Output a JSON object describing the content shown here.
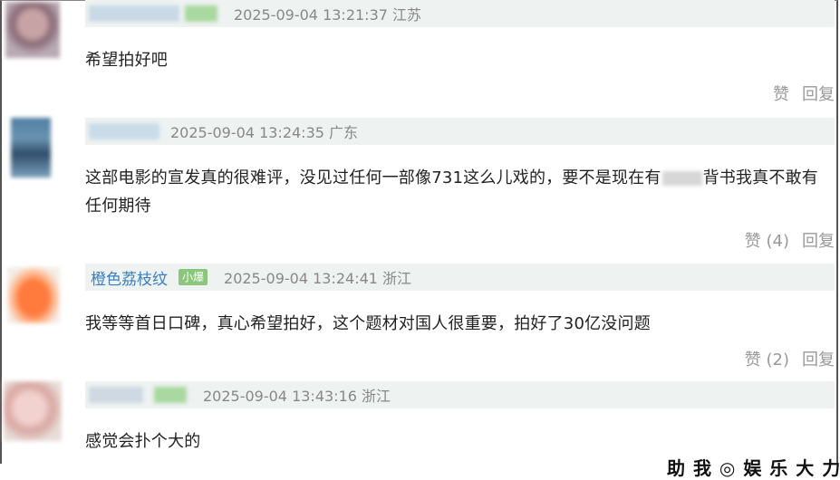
{
  "comments": [
    {
      "timestamp": "2025-09-04 13:21:37",
      "location": "江苏",
      "text": "希望拍好吧",
      "like_label": "赞",
      "reply_label": "回复"
    },
    {
      "timestamp": "2025-09-04 13:24:35",
      "location": "广东",
      "text_before": "这部电影的宣发真的很难评，没见过任何一部像731这么儿戏的，要不是现在有",
      "text_after": "背书我真不敢有任何期待",
      "like_label": "赞 (4)",
      "reply_label": "回复"
    },
    {
      "username": "橙色荔枝纹",
      "badge": "小爆",
      "timestamp": "2025-09-04 13:24:41",
      "location": "浙江",
      "text": "我等等首日口碑，真心希望拍好，这个题材对国人很重要，拍好了30亿没问题",
      "like_label": "赞 (2)",
      "reply_label": "回复"
    },
    {
      "timestamp": "2025-09-04 13:43:16",
      "location": "浙江",
      "text": "感觉会扑个大的"
    }
  ],
  "watermark": "助 我 ◎ 娱 乐 大 力",
  "colors": {
    "header_bg": "#eef2f1",
    "username": "#3a7fbf",
    "badge": "#8ac77c",
    "muted": "#999999"
  }
}
